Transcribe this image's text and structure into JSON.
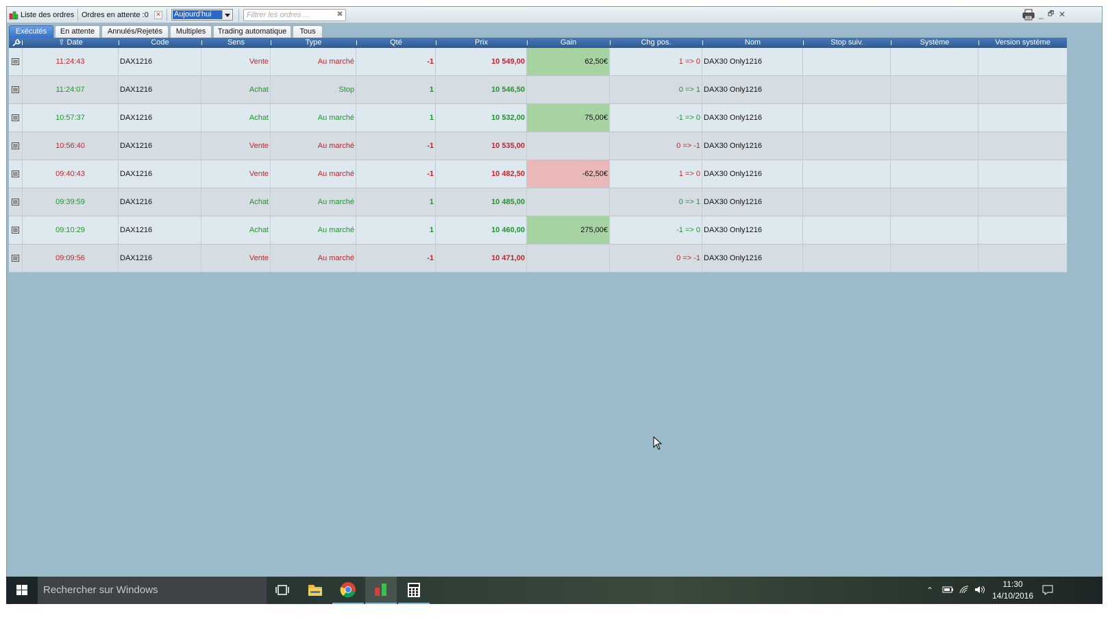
{
  "toolbar": {
    "title": "Liste des ordres",
    "pending_label": "Ordres en attente :0",
    "date_filter": "Aujourd'hui",
    "filter_placeholder": "Filtrer les ordres ...",
    "filter_clear": "✖",
    "pending_close": "✕"
  },
  "window_controls": {
    "minimize": "_",
    "restore": "🗗",
    "close": "✕"
  },
  "tabs": [
    {
      "label": "Exécutés",
      "active": true
    },
    {
      "label": "En attente"
    },
    {
      "label": "Annulés/Rejetés"
    },
    {
      "label": "Multiples"
    },
    {
      "label": "Trading automatique"
    },
    {
      "label": "Tous"
    }
  ],
  "columns": {
    "date": "Date",
    "code": "Code",
    "sens": "Sens",
    "type": "Type",
    "qte": "Qté",
    "prix": "Prix",
    "gain": "Gain",
    "chg_pos": "Chg pos.",
    "nom": "Nom",
    "stop_suiv": "Stop suiv.",
    "systeme": "Système",
    "version_systeme": "Version système"
  },
  "orders": [
    {
      "date": "11:24:43",
      "code": "DAX1216",
      "sens": "Vente",
      "type": "Au marché",
      "qte": "-1",
      "prix": "10 549,00",
      "gain": "62,50€",
      "chg_pos": "1 => 0",
      "nom": "DAX30 Only1216",
      "stop_suiv": "",
      "systeme": "",
      "version_systeme": "",
      "side": "sell",
      "gain_sign": "pos"
    },
    {
      "date": "11:24:07",
      "code": "DAX1216",
      "sens": "Achat",
      "type": "Stop",
      "qte": "1",
      "prix": "10 546,50",
      "gain": "",
      "chg_pos": "0 => 1",
      "nom": "DAX30 Only1216",
      "stop_suiv": "",
      "systeme": "",
      "version_systeme": "",
      "side": "buy",
      "gain_sign": ""
    },
    {
      "date": "10:57:37",
      "code": "DAX1216",
      "sens": "Achat",
      "type": "Au marché",
      "qte": "1",
      "prix": "10 532,00",
      "gain": "75,00€",
      "chg_pos": "-1 => 0",
      "nom": "DAX30 Only1216",
      "stop_suiv": "",
      "systeme": "",
      "version_systeme": "",
      "side": "buy",
      "gain_sign": "pos"
    },
    {
      "date": "10:56:40",
      "code": "DAX1216",
      "sens": "Vente",
      "type": "Au marché",
      "qte": "-1",
      "prix": "10 535,00",
      "gain": "",
      "chg_pos": "0 => -1",
      "nom": "DAX30 Only1216",
      "stop_suiv": "",
      "systeme": "",
      "version_systeme": "",
      "side": "sell",
      "gain_sign": ""
    },
    {
      "date": "09:40:43",
      "code": "DAX1216",
      "sens": "Vente",
      "type": "Au marché",
      "qte": "-1",
      "prix": "10 482,50",
      "gain": "-62,50€",
      "chg_pos": "1 => 0",
      "nom": "DAX30 Only1216",
      "stop_suiv": "",
      "systeme": "",
      "version_systeme": "",
      "side": "sell",
      "gain_sign": "neg"
    },
    {
      "date": "09:39:59",
      "code": "DAX1216",
      "sens": "Achat",
      "type": "Au marché",
      "qte": "1",
      "prix": "10 485,00",
      "gain": "",
      "chg_pos": "0 => 1",
      "nom": "DAX30 Only1216",
      "stop_suiv": "",
      "systeme": "",
      "version_systeme": "",
      "side": "buy",
      "gain_sign": ""
    },
    {
      "date": "09:10:29",
      "code": "DAX1216",
      "sens": "Achat",
      "type": "Au marché",
      "qte": "1",
      "prix": "10 460,00",
      "gain": "275,00€",
      "chg_pos": "-1 => 0",
      "nom": "DAX30 Only1216",
      "stop_suiv": "",
      "systeme": "",
      "version_systeme": "",
      "side": "buy",
      "gain_sign": "pos"
    },
    {
      "date": "09:09:56",
      "code": "DAX1216",
      "sens": "Vente",
      "type": "Au marché",
      "qte": "-1",
      "prix": "10 471,00",
      "gain": "",
      "chg_pos": "0 => -1",
      "nom": "DAX30 Only1216",
      "stop_suiv": "",
      "systeme": "",
      "version_systeme": "",
      "side": "sell",
      "gain_sign": ""
    }
  ],
  "colors": {
    "sell": "#c0262a",
    "buy": "#22922e",
    "gain_positive_bg": "#a6d3a1",
    "gain_negative_bg": "#eab8b8",
    "header_bg": "#3a6aa6",
    "panel_bg": "#9cbbca"
  },
  "taskbar": {
    "search_placeholder": "Rechercher sur Windows",
    "time": "11:30",
    "date": "14/10/2016",
    "apps": [
      "task-view-icon",
      "file-explorer-icon",
      "chrome-icon",
      "trading-app-icon",
      "calculator-icon"
    ]
  }
}
